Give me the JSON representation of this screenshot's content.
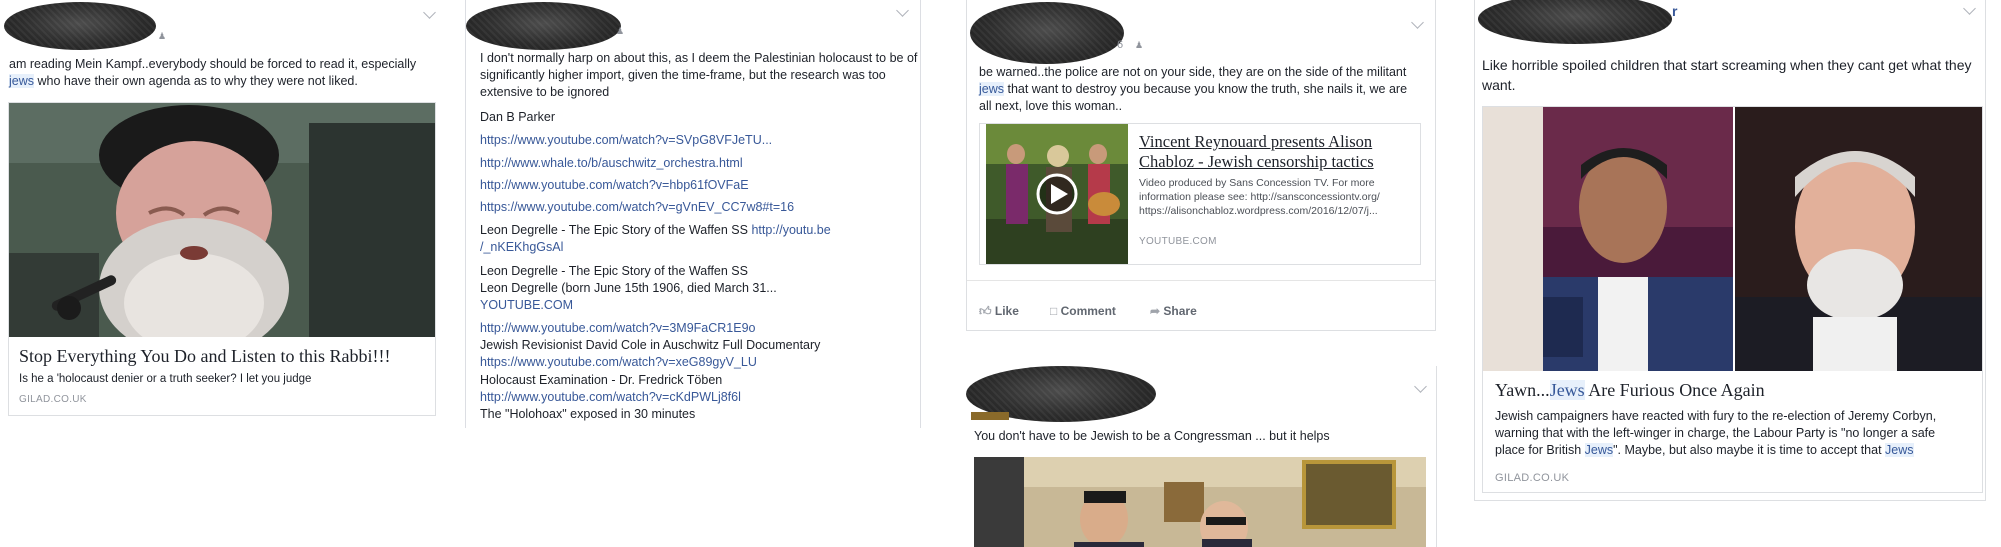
{
  "posts": {
    "p1": {
      "body": "am reading Mein Kampf..everybody should be forced to read it, especially",
      "body_hl": "jews",
      "body_tail": " who have their own agenda as to why they were not liked.",
      "card": {
        "title": "Stop Everything You Do and Listen to this Rabbi!!!",
        "desc": "Is he a 'holocaust denier or a truth seeker? I let you judge",
        "source": "GILAD.CO.UK"
      }
    },
    "p2": {
      "body": "I don't normally harp on about this, as I deem the Palestinian holocaust to be of significantly higher import, given the time-frame, but the research was too extensive to be ignored",
      "lines": [
        {
          "text": "Dan B Parker",
          "link": false
        },
        {
          "text": "https://www.youtube.com/watch?v=SVpG8VFJeTU...",
          "link": true
        },
        {
          "text": "http://www.whale.to/b/auschwitz_orchestra.html",
          "link": true
        },
        {
          "text": "http://www.youtube.com/watch?v=hbp61fOVFaE",
          "link": true
        },
        {
          "text": "https://www.youtube.com/watch?v=gVnEV_CC7w8#t=16",
          "link": true
        }
      ],
      "degrelle1_text": "Leon Degrelle - The Epic Story of the Waffen SS ",
      "degrelle1_link": "http://youtu.be",
      "degrelle1_link2": "/_nKEKhgGsAl",
      "degrelle2_title": "Leon Degrelle - The Epic Story of the Waffen SS",
      "degrelle2_sub": "Leon Degrelle (born June 15th 1906, died March 31...",
      "degrelle2_src": "YOUTUBE.COM",
      "tail": [
        {
          "text": "http://www.youtube.com/watch?v=3M9FaCR1E9o",
          "link": true
        },
        {
          "text": "Jewish Revisionist David Cole in Auschwitz Full Documentary",
          "link": false
        },
        {
          "text": "https://www.youtube.com/watch?v=xeG89gyV_LU",
          "link": true
        },
        {
          "text": "Holocaust Examination - Dr. Fredrick Töben",
          "link": false
        },
        {
          "text": "http://www.youtube.com/watch?v=cKdPWLj8f6l",
          "link": true
        },
        {
          "text": "The \"Holohoax\" exposed in 30 minutes",
          "link": false
        }
      ]
    },
    "p3": {
      "body_a": "be warned..the police are not on your side, they are on the side of the militant ",
      "body_hl": "jews",
      "body_b": " that want to destroy you because you know the truth, she nails it, we are all next, love this woman..",
      "meta_num": "6",
      "card": {
        "title": "Vincent Reynouard presents Alison Chabloz - Jewish censorship tactics",
        "desc": "Video produced by Sans Concession TV. For more information please see: http://sansconcessiontv.org/ https://alisonchabloz.wordpress.com/2016/12/07/j...",
        "source": "YOUTUBE.COM"
      },
      "actions": {
        "like": "Like",
        "comment": "Comment",
        "share": "Share"
      }
    },
    "p4": {
      "body": "You don't have to be Jewish to be a Congressman ... but it helps"
    },
    "p5": {
      "name_tail": "r",
      "body": "Like horrible spoiled children that start screaming when they cant get what they want.",
      "card": {
        "title_a": "Yawn...",
        "title_hl": "Jews",
        "title_b": " Are Furious Once Again",
        "desc_a": "Jewish campaigners have reacted with fury to the re-election of Jeremy Corbyn, warning that with the left-winger in charge, the Labour Party is \"no longer a safe place for British ",
        "desc_hl1": "Jews",
        "desc_b": "\". Maybe, but also maybe it is time to accept that ",
        "desc_hl2": "Jews",
        "source": "GILAD.CO.UK"
      }
    }
  },
  "colors": {
    "link": "#385898",
    "highlight": "#e7f0fb",
    "text": "#1d2129",
    "meta": "#90949c",
    "border": "#dddfe2"
  }
}
